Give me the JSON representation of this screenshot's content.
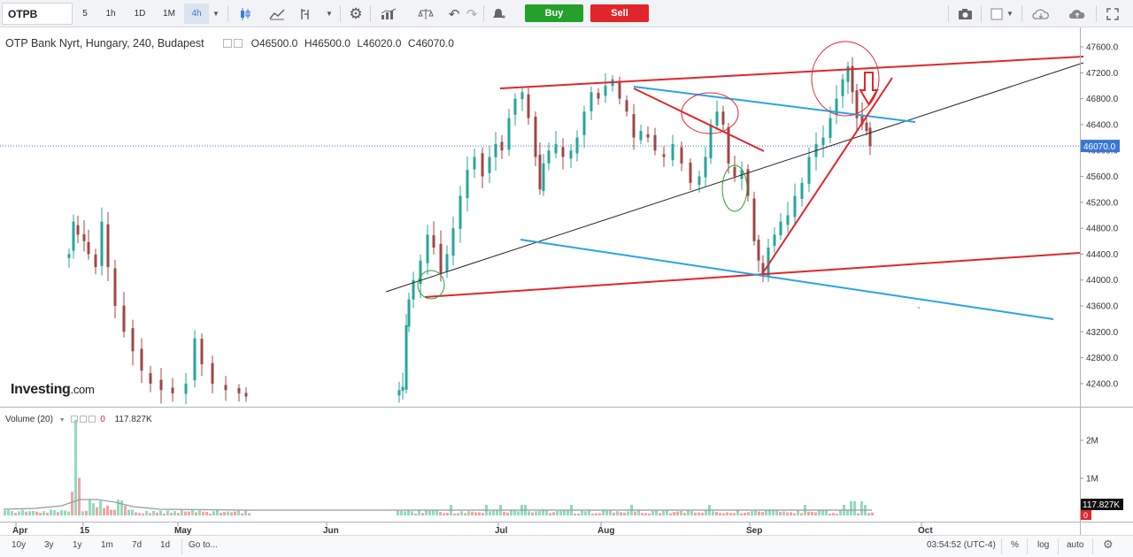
{
  "toolbar": {
    "symbol": "OTPB",
    "timeframes": [
      "5",
      "1h",
      "1D",
      "1M",
      "4h"
    ],
    "active_timeframe": "4h",
    "buy_label": "Buy",
    "sell_label": "Sell"
  },
  "legend": {
    "title": "OTP Bank Nyrt, Hungary, 240, Budapest",
    "open": "O46500.0",
    "high": "H46500.0",
    "low": "L46020.0",
    "close": "C46070.0"
  },
  "logo": {
    "brand": "Investing",
    "suffix": ".com"
  },
  "volume": {
    "label": "Volume (20)",
    "zero": "0",
    "value": "117.827K"
  },
  "price_axis": {
    "ticks": [
      "47600.0",
      "47200.0",
      "46800.0",
      "46400.0",
      "46000.0",
      "45600.0",
      "45200.0",
      "44800.0",
      "44400.0",
      "44000.0",
      "43600.0",
      "43200.0",
      "42800.0",
      "42400.0"
    ],
    "current_price": "46070.0"
  },
  "volume_axis": {
    "ticks": [
      "2M",
      "1M"
    ],
    "current": "117.827K",
    "zero": "0"
  },
  "time_axis": [
    "Apr",
    "15",
    "May",
    "Jun",
    "Jul",
    "Aug",
    "Sep",
    "Oct"
  ],
  "bottom_bar": {
    "ranges": [
      "10y",
      "3y",
      "1y",
      "1m",
      "7d",
      "1d"
    ],
    "goto": "Go to...",
    "clock": "03:54:52 (UTC-4)",
    "percent": "%",
    "log": "log",
    "auto": "auto"
  },
  "colors": {
    "up": "#26a69a",
    "down": "#a04646",
    "trend_red": "#e0262b",
    "trend_blue": "#29a3e6",
    "price_label": "#3a76d6"
  }
}
